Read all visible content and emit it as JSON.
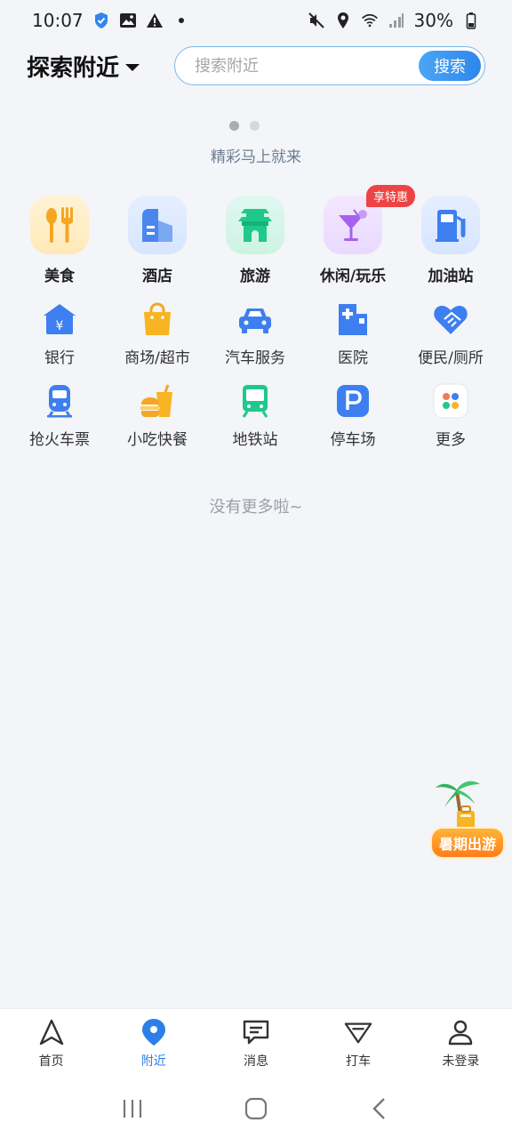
{
  "status_bar": {
    "time": "10:07",
    "battery": "30%"
  },
  "header": {
    "title": "探索附近",
    "search_placeholder": "搜索附近",
    "search_button": "搜索"
  },
  "banner": {
    "text": "精彩马上就来",
    "dots": 2,
    "active_dot": 0
  },
  "big_categories": [
    {
      "label": "美食",
      "icon": "fork-spoon-icon"
    },
    {
      "label": "酒店",
      "icon": "hotel-building-icon"
    },
    {
      "label": "旅游",
      "icon": "pavilion-icon"
    },
    {
      "label": "休闲/玩乐",
      "icon": "cocktail-icon",
      "badge": "享特惠"
    },
    {
      "label": "加油站",
      "icon": "fuel-pump-icon"
    }
  ],
  "small_categories": [
    [
      {
        "label": "银行",
        "icon": "bank-icon"
      },
      {
        "label": "商场/超市",
        "icon": "shopping-bag-icon"
      },
      {
        "label": "汽车服务",
        "icon": "car-icon"
      },
      {
        "label": "医院",
        "icon": "hospital-icon"
      },
      {
        "label": "便民/厕所",
        "icon": "handshake-heart-icon"
      }
    ],
    [
      {
        "label": "抢火车票",
        "icon": "train-icon"
      },
      {
        "label": "小吃快餐",
        "icon": "fast-food-icon"
      },
      {
        "label": "地铁站",
        "icon": "subway-icon"
      },
      {
        "label": "停车场",
        "icon": "parking-icon"
      },
      {
        "label": "更多",
        "icon": "more-dots-icon"
      }
    ]
  ],
  "no_more": "没有更多啦~",
  "float_promo": {
    "label": "暑期出游"
  },
  "bottom_nav": [
    {
      "label": "首页",
      "icon": "navigate-arrow-icon",
      "active": false
    },
    {
      "label": "附近",
      "icon": "location-pin-icon",
      "active": true
    },
    {
      "label": "消息",
      "icon": "message-icon",
      "active": false
    },
    {
      "label": "打车",
      "icon": "taxi-icon",
      "active": false
    },
    {
      "label": "未登录",
      "icon": "user-icon",
      "active": false
    }
  ],
  "colors": {
    "accent": "#2d7fe8",
    "background": "#f3f5f8",
    "badge": "#ec4444"
  }
}
